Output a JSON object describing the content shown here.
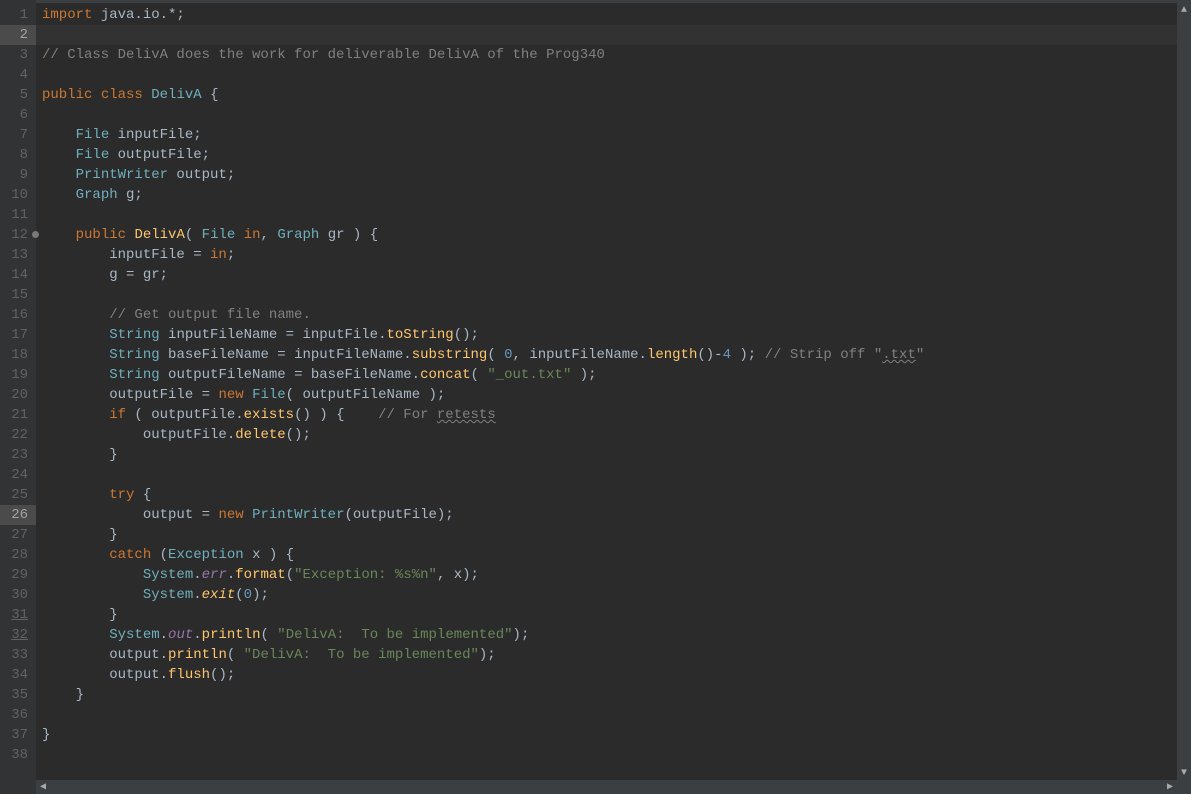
{
  "lineNumbers": [
    "1",
    "2",
    "3",
    "4",
    "5",
    "6",
    "7",
    "8",
    "9",
    "10",
    "11",
    "12",
    "13",
    "14",
    "15",
    "16",
    "17",
    "18",
    "19",
    "20",
    "21",
    "22",
    "23",
    "24",
    "25",
    "26",
    "27",
    "28",
    "29",
    "30",
    "31",
    "32",
    "33",
    "34",
    "35",
    "36",
    "37",
    "38"
  ],
  "currentLine": 2,
  "highlightedLine": 26,
  "underlinedLines": [
    31,
    32
  ],
  "markerLines": [
    12
  ],
  "code": {
    "l1": {
      "t1": "import",
      "t2": " java.io.*;"
    },
    "l3": {
      "t1": "// Class DelivA does the work for deliverable DelivA of the Prog340"
    },
    "l5": {
      "t1": "public",
      "t2": " ",
      "t3": "class",
      "t4": " ",
      "t5": "DelivA",
      "t6": " {"
    },
    "l7": {
      "t1": "    ",
      "t2": "File",
      "t3": " inputFile;"
    },
    "l8": {
      "t1": "    ",
      "t2": "File",
      "t3": " outputFile;"
    },
    "l9": {
      "t1": "    ",
      "t2": "PrintWriter",
      "t3": " output;"
    },
    "l10": {
      "t1": "    ",
      "t2": "Graph",
      "t3": " g;"
    },
    "l12": {
      "t1": "    ",
      "t2": "public",
      "t3": " ",
      "t4": "DelivA",
      "t5": "( ",
      "t6": "File",
      "t7": " ",
      "t8": "in",
      "t9": ", ",
      "t10": "Graph",
      "t11": " gr ) {"
    },
    "l13": {
      "t1": "        inputFile = ",
      "t2": "in",
      "t3": ";"
    },
    "l14": {
      "t1": "        g = gr;"
    },
    "l16": {
      "t1": "        ",
      "t2": "// Get output file name."
    },
    "l17": {
      "t1": "        ",
      "t2": "String",
      "t3": " inputFileName = inputFile.",
      "t4": "toString",
      "t5": "();"
    },
    "l18": {
      "t1": "        ",
      "t2": "String",
      "t3": " baseFileName = inputFileName.",
      "t4": "substring",
      "t5": "( ",
      "t6": "0",
      "t7": ", inputFileName.",
      "t8": "length",
      "t9": "()-",
      "t10": "4",
      "t11": " ); ",
      "t12": "// Strip off \"",
      "t13": ".txt",
      "t14": "\""
    },
    "l19": {
      "t1": "        ",
      "t2": "String",
      "t3": " outputFileName = baseFileName.",
      "t4": "concat",
      "t5": "( ",
      "t6": "\"_out.txt\"",
      "t7": " );"
    },
    "l20": {
      "t1": "        outputFile = ",
      "t2": "new",
      "t3": " ",
      "t4": "File",
      "t5": "( outputFileName );"
    },
    "l21": {
      "t1": "        ",
      "t2": "if",
      "t3": " ( outputFile.",
      "t4": "exists",
      "t5": "() ) {    ",
      "t6": "// For ",
      "t7": "retests"
    },
    "l22": {
      "t1": "            outputFile.",
      "t2": "delete",
      "t3": "();"
    },
    "l23": {
      "t1": "        }"
    },
    "l25": {
      "t1": "        ",
      "t2": "try",
      "t3": " {"
    },
    "l26": {
      "t1": "            output = ",
      "t2": "new",
      "t3": " ",
      "t4": "PrintWriter",
      "t5": "(outputFile);"
    },
    "l27": {
      "t1": "        }"
    },
    "l28": {
      "t1": "        ",
      "t2": "catch",
      "t3": " (",
      "t4": "Exception",
      "t5": " x ) {"
    },
    "l29": {
      "t1": "            ",
      "t2": "System",
      "t3": ".",
      "t4": "err",
      "t5": ".",
      "t6": "format",
      "t7": "(",
      "t8": "\"Exception: %s%n\"",
      "t9": ", x);"
    },
    "l30": {
      "t1": "            ",
      "t2": "System",
      "t3": ".",
      "t4": "exit",
      "t5": "(",
      "t6": "0",
      "t7": ");"
    },
    "l31": {
      "t1": "        }"
    },
    "l32": {
      "t1": "        ",
      "t2": "System",
      "t3": ".",
      "t4": "out",
      "t5": ".",
      "t6": "println",
      "t7": "( ",
      "t8": "\"DelivA:  To be implemented\"",
      "t9": ");"
    },
    "l33": {
      "t1": "        output.",
      "t2": "println",
      "t3": "( ",
      "t4": "\"DelivA:  To be implemented\"",
      "t5": ");"
    },
    "l34": {
      "t1": "        output.",
      "t2": "flush",
      "t3": "();"
    },
    "l35": {
      "t1": "    }"
    },
    "l37": {
      "t1": "}"
    }
  }
}
